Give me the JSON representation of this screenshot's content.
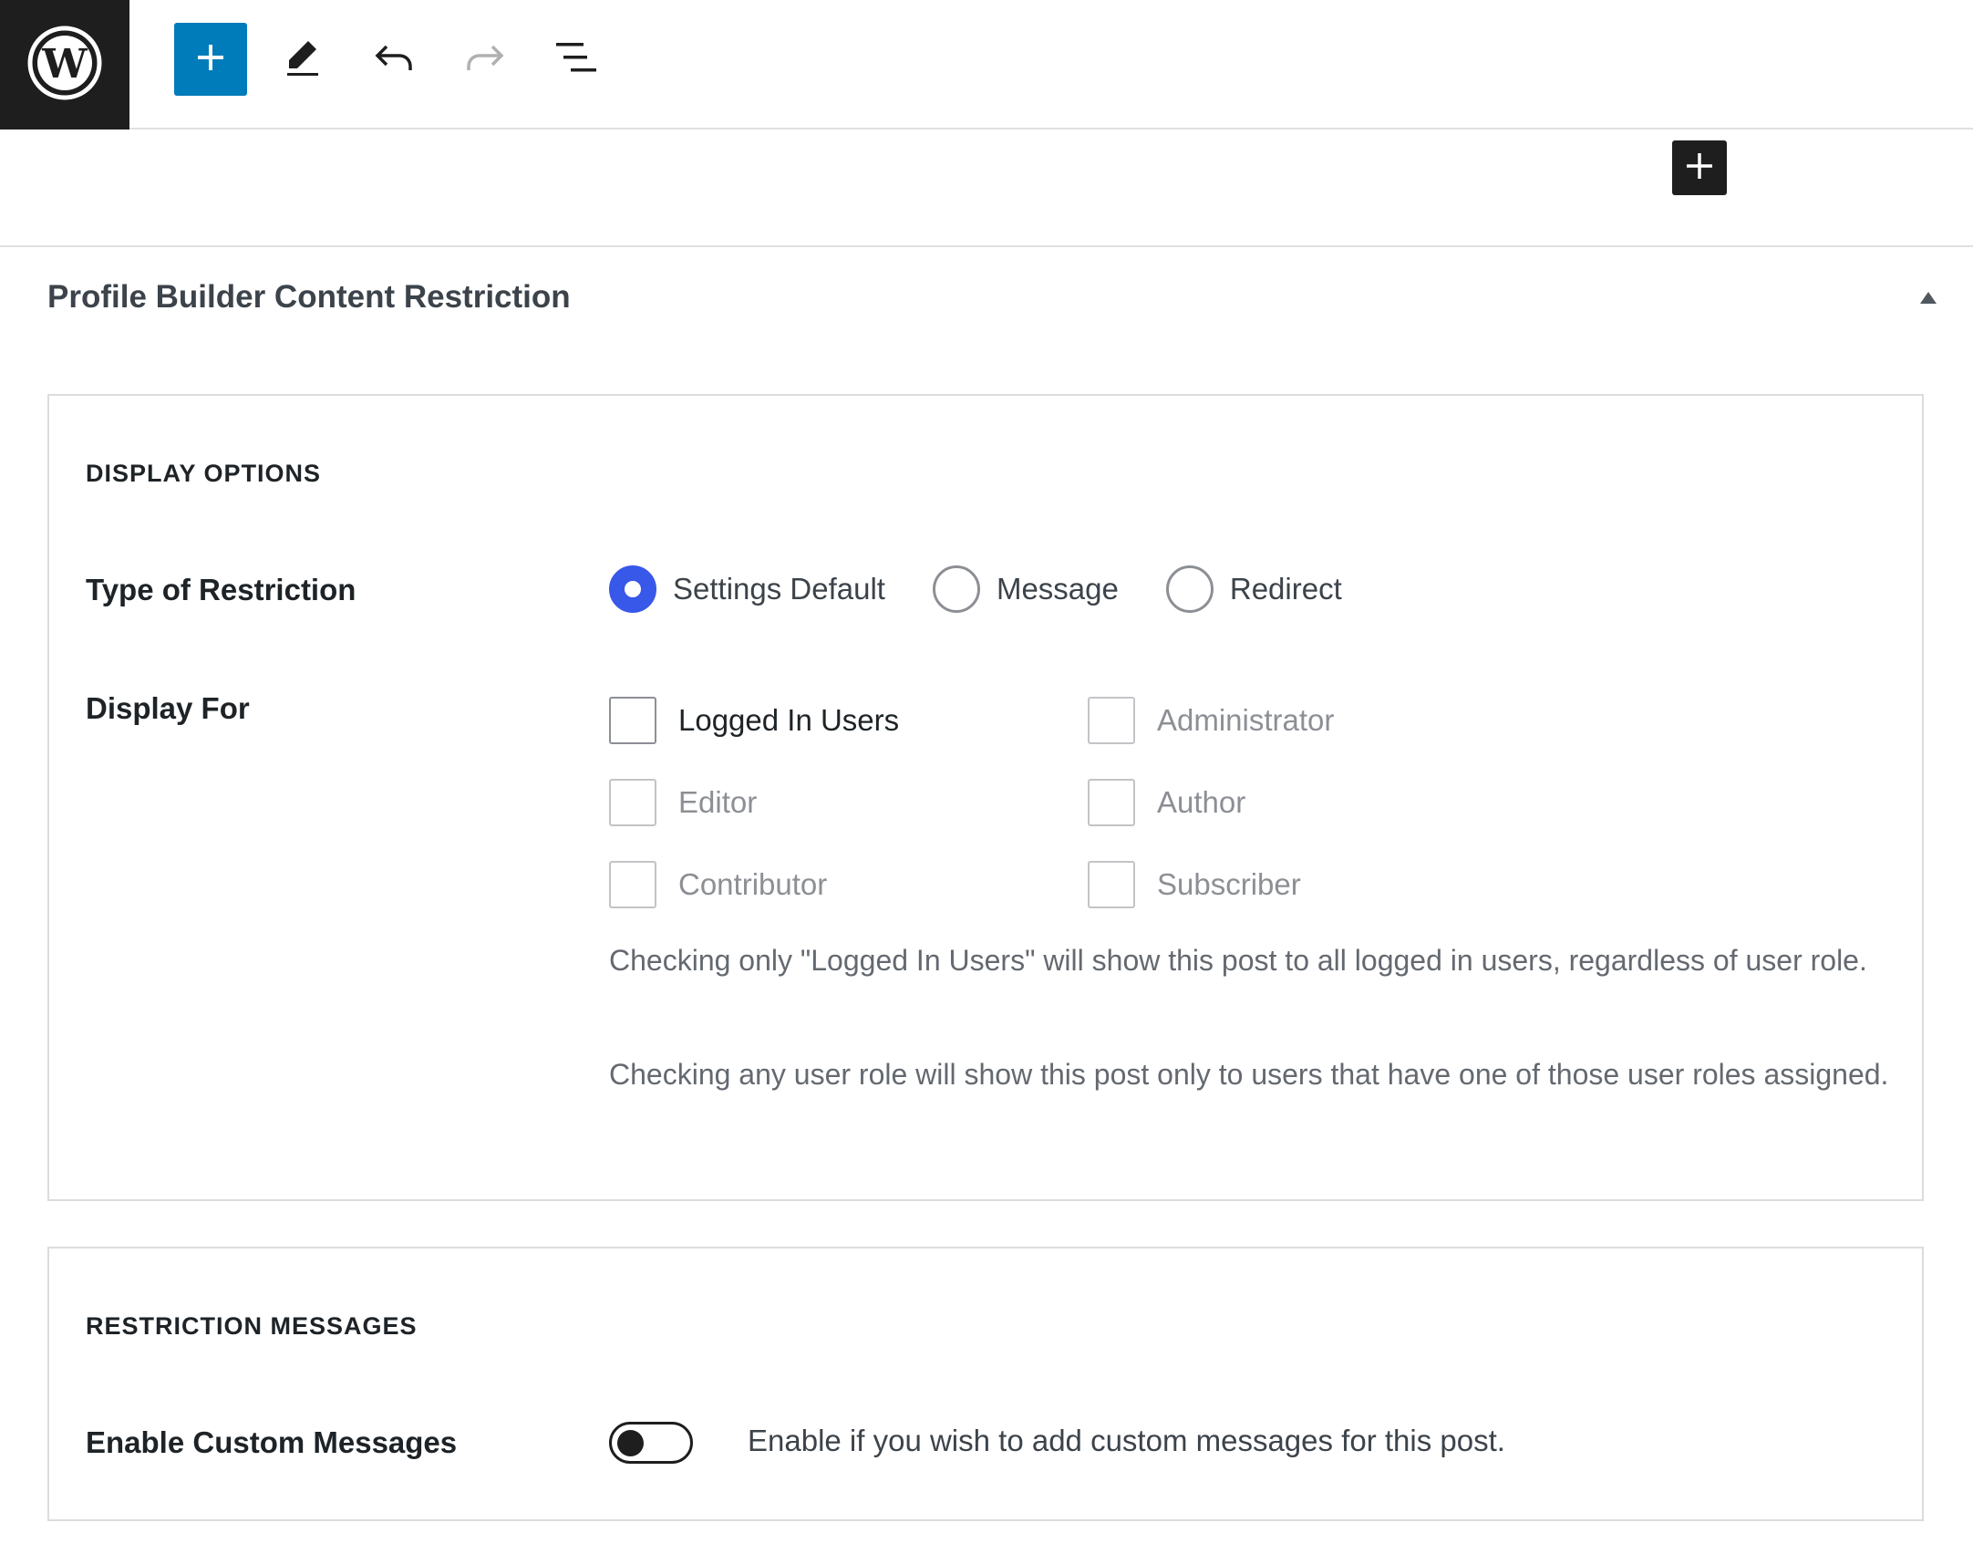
{
  "toolbar": {
    "logo_icon": "wordpress-icon",
    "add_icon": "plus-icon",
    "edit_icon": "pencil-icon",
    "undo_icon": "undo-icon",
    "redo_icon": "redo-icon",
    "list_view_icon": "list-view-icon",
    "accent_color": "#007cba"
  },
  "editor": {
    "inserter_icon": "plus-icon"
  },
  "panel": {
    "title": "Profile Builder Content Restriction",
    "toggle_icon": "caret-up-icon",
    "display_options": {
      "heading": "DISPLAY OPTIONS",
      "type_label": "Type of Restriction",
      "restriction_types": [
        {
          "label": "Settings Default",
          "checked": true
        },
        {
          "label": "Message",
          "checked": false
        },
        {
          "label": "Redirect",
          "checked": false
        }
      ],
      "display_for_label": "Display For",
      "roles": [
        {
          "label": "Logged In Users",
          "checked": false,
          "disabled": false
        },
        {
          "label": "Administrator",
          "checked": false,
          "disabled": true
        },
        {
          "label": "Editor",
          "checked": false,
          "disabled": true
        },
        {
          "label": "Author",
          "checked": false,
          "disabled": true
        },
        {
          "label": "Contributor",
          "checked": false,
          "disabled": true
        },
        {
          "label": "Subscriber",
          "checked": false,
          "disabled": true
        }
      ],
      "help_1": "Checking only \"Logged In Users\" will show this post to all logged in users, regardless of user role.",
      "help_2": "Checking any user role will show this post only to users that have one of those user roles assigned.",
      "radio_color": "#3858e9"
    },
    "restriction_messages": {
      "heading": "RESTRICTION MESSAGES",
      "enable_label": "Enable Custom Messages",
      "enable_on": false,
      "enable_desc": "Enable if you wish to add custom messages for this post."
    }
  }
}
